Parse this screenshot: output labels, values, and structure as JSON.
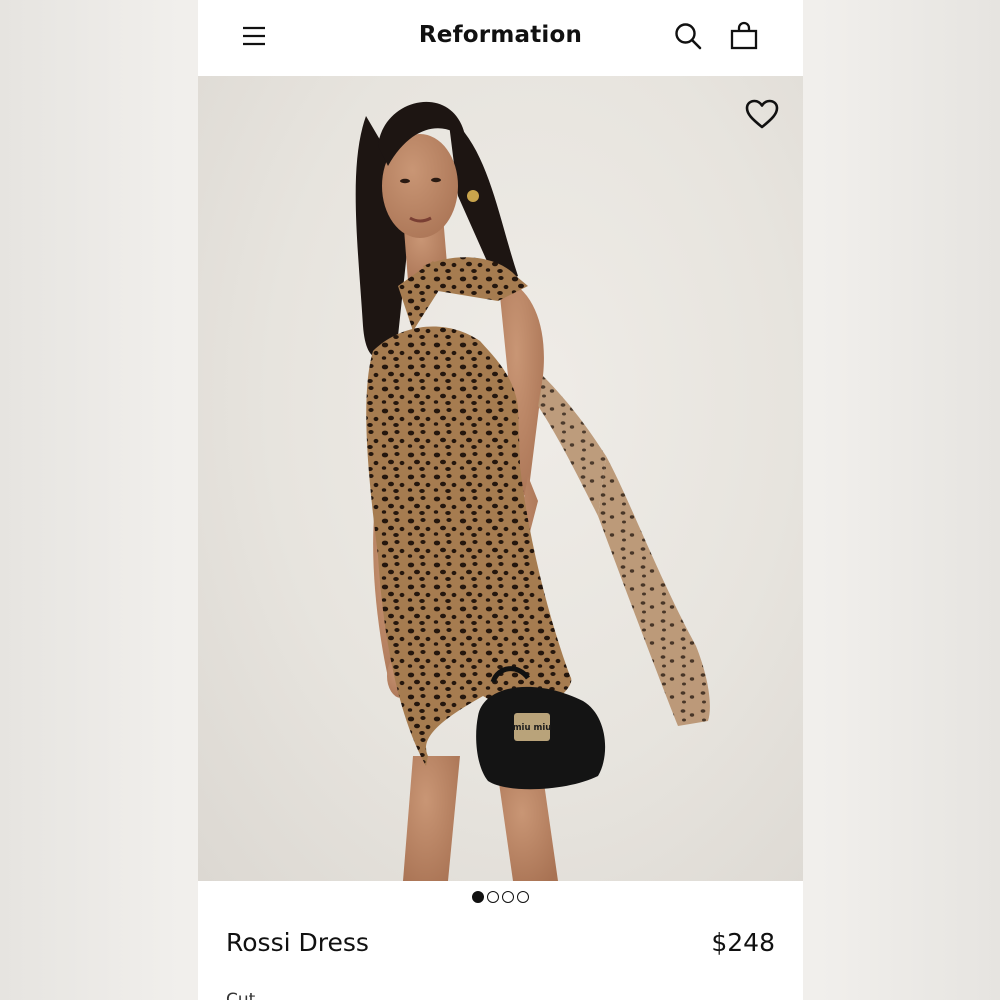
{
  "header": {
    "brand": "Reformation",
    "icons": [
      "menu-icon",
      "search-icon",
      "shopping-bag-icon"
    ]
  },
  "hero": {
    "favorite_icon": "heart-icon",
    "bag_logo_text": "miu miu"
  },
  "carousel": {
    "count": 4,
    "active_index": 0
  },
  "product": {
    "name": "Rossi Dress",
    "price": "$248",
    "next_line_partial": "Cut..."
  },
  "colors": {
    "text": "#111111",
    "background": "#ffffff",
    "print_base": "#a07a52",
    "print_spot": "#2a1a10"
  }
}
